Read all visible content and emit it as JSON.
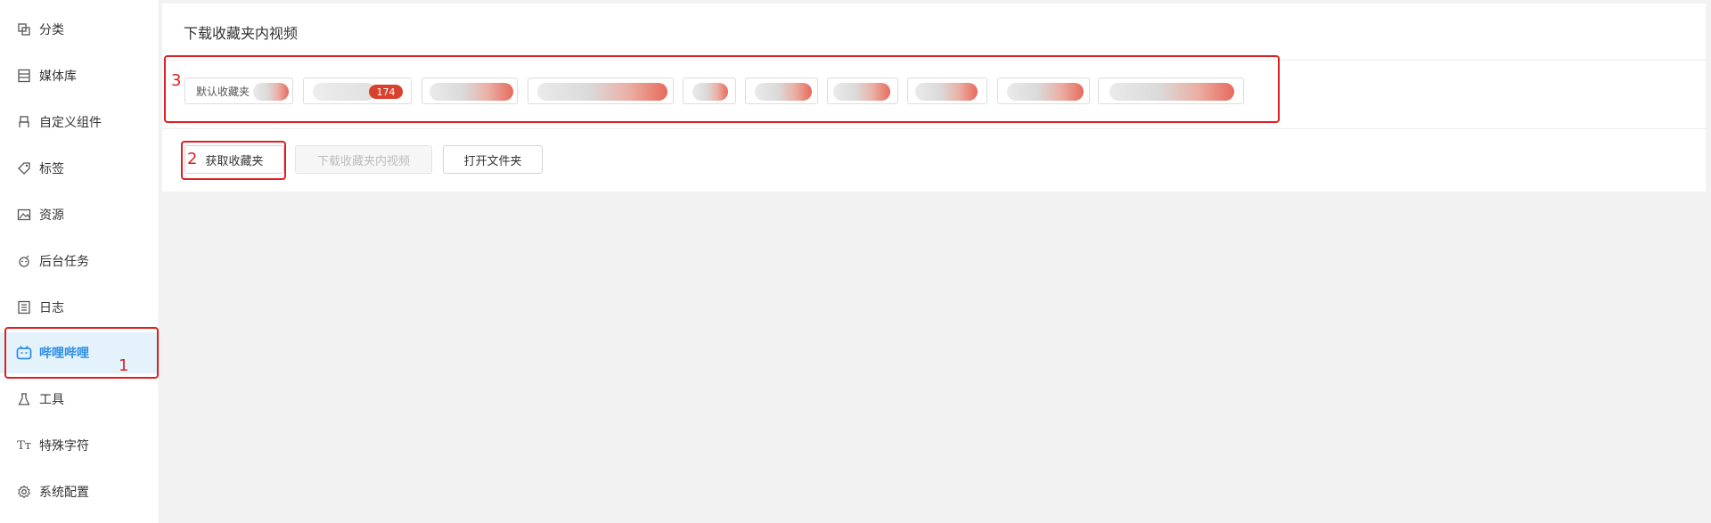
{
  "sidebar": {
    "items": [
      {
        "label": "分类",
        "icon": "category-icon"
      },
      {
        "label": "媒体库",
        "icon": "media-library-icon"
      },
      {
        "label": "自定义组件",
        "icon": "custom-component-icon"
      },
      {
        "label": "标签",
        "icon": "tag-icon"
      },
      {
        "label": "资源",
        "icon": "image-icon"
      },
      {
        "label": "后台任务",
        "icon": "background-task-icon"
      },
      {
        "label": "日志",
        "icon": "log-icon"
      },
      {
        "label": "哔哩哔哩",
        "icon": "bilibili-icon",
        "active": true
      },
      {
        "label": "工具",
        "icon": "flask-icon"
      },
      {
        "label": "特殊字符",
        "icon": "text-type-icon"
      },
      {
        "label": "系统配置",
        "icon": "settings-gear-icon"
      }
    ]
  },
  "main": {
    "title": "下载收藏夹内视频",
    "favorites": [
      {
        "label": "默认收藏夹"
      },
      {
        "label": "",
        "badge": "174"
      },
      {
        "label": ""
      },
      {
        "label": ""
      },
      {
        "label": ""
      },
      {
        "label": ""
      },
      {
        "label": ""
      },
      {
        "label": ""
      },
      {
        "label": ""
      },
      {
        "label": ""
      }
    ],
    "buttons": {
      "fetch": "获取收藏夹",
      "download": "下载收藏夹内视频",
      "open_folder": "打开文件夹"
    }
  },
  "annotations": {
    "n1": "1",
    "n2": "2",
    "n3": "3"
  },
  "colors": {
    "accent": "#2f8fe6",
    "annotation_red": "#e02020",
    "badge_red": "#d9412e"
  }
}
